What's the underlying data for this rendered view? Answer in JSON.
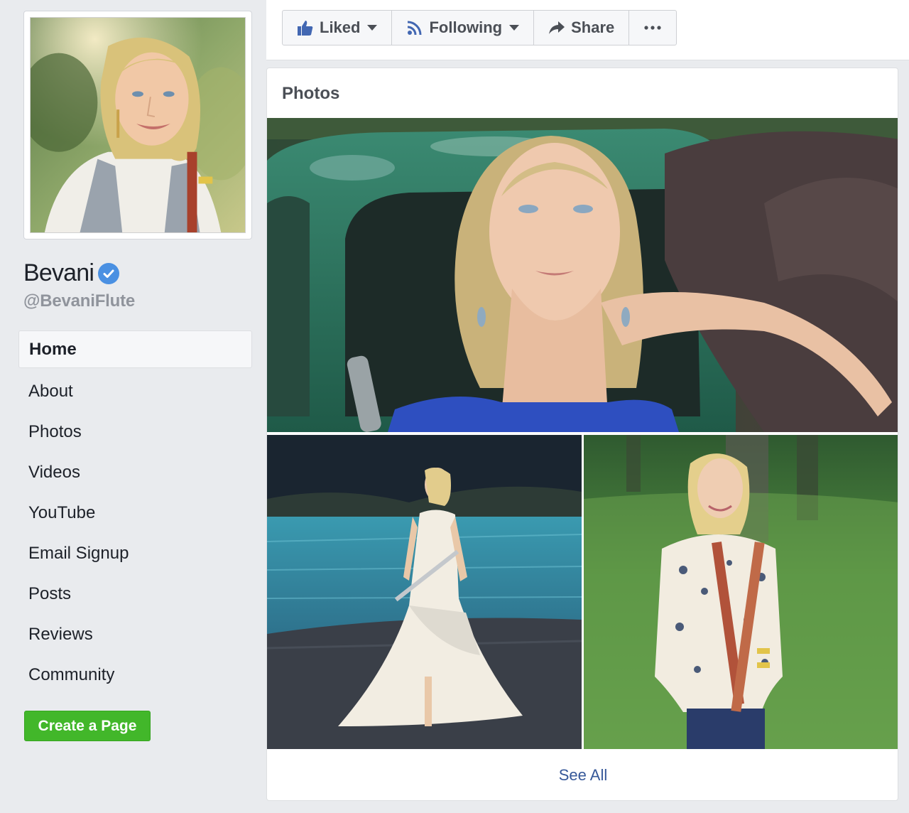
{
  "page": {
    "name": "Bevani",
    "handle": "@BevaniFlute",
    "verified": true,
    "accent_color": "#4a90e2"
  },
  "nav": {
    "items": [
      {
        "label": "Home",
        "active": true
      },
      {
        "label": "About"
      },
      {
        "label": "Photos"
      },
      {
        "label": "Videos"
      },
      {
        "label": "YouTube"
      },
      {
        "label": "Email Signup"
      },
      {
        "label": "Posts"
      },
      {
        "label": "Reviews"
      },
      {
        "label": "Community"
      }
    ]
  },
  "create_page": {
    "label": "Create a Page",
    "color": "#42b72a"
  },
  "actions": {
    "liked": {
      "label": "Liked",
      "icon": "thumbs-up-icon"
    },
    "following": {
      "label": "Following",
      "icon": "rss-icon"
    },
    "share": {
      "label": "Share",
      "icon": "share-arrow-icon"
    },
    "more": {
      "icon": "more-dots-icon"
    }
  },
  "photos": {
    "title": "Photos",
    "see_all": "See All",
    "link_color": "#365899"
  }
}
